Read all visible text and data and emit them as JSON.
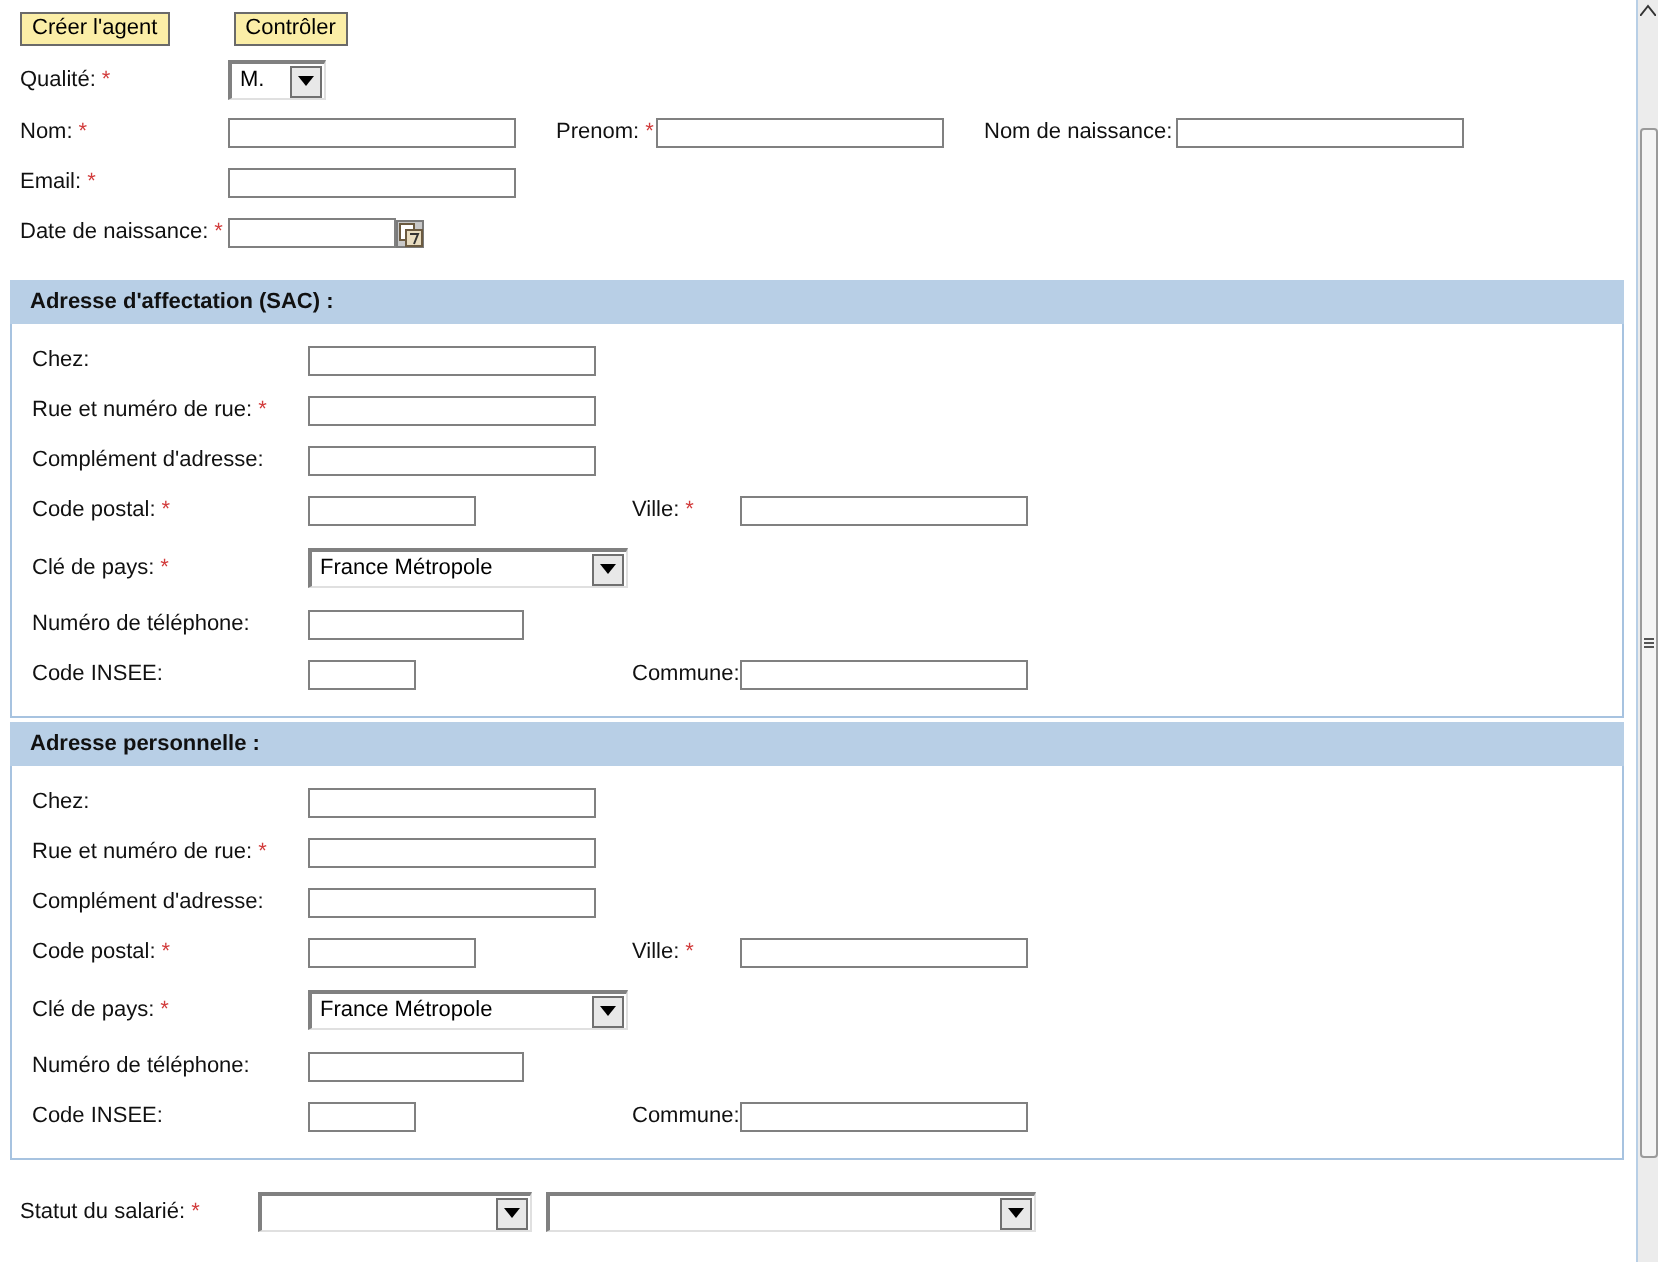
{
  "buttons": [
    {
      "label": "Créer l'agent"
    },
    {
      "label": "Contrôler"
    }
  ],
  "top_rows": [
    [
      {
        "label": "Qualité:",
        "required_mark": "*",
        "kind": "select",
        "value": "M."
      }
    ],
    [
      {
        "label": "Nom:",
        "required_mark": "*",
        "kind": "text"
      },
      {
        "label": "Prenom:",
        "required_mark": "*",
        "kind": "text"
      },
      {
        "label": "Nom de naissance:",
        "kind": "text"
      }
    ],
    [
      {
        "label": "Email:",
        "required_mark": "*",
        "kind": "text"
      }
    ],
    [
      {
        "label": "Date de naissance:",
        "required_mark": "*",
        "kind": "date"
      }
    ]
  ],
  "sections": [
    {
      "title": "Adresse d'affectation (SAC) :",
      "rows": [
        [
          {
            "label": "Chez:",
            "kind": "text"
          }
        ],
        [
          {
            "label": "Rue et numéro de rue:",
            "required_mark": "*",
            "kind": "text"
          }
        ],
        [
          {
            "label": "Complément d'adresse:",
            "kind": "text"
          }
        ],
        [
          {
            "label": "Code postal:",
            "required_mark": "*",
            "kind": "text"
          },
          {
            "label": "Ville:",
            "required_mark": "*",
            "kind": "text"
          }
        ],
        [
          {
            "label": "Clé de pays:",
            "required_mark": "*",
            "kind": "select",
            "value": "France Métropole"
          }
        ],
        [
          {
            "label": "Numéro de téléphone:",
            "kind": "text"
          }
        ],
        [
          {
            "label": "Code INSEE:",
            "kind": "text"
          },
          {
            "label": "Commune:",
            "kind": "text"
          }
        ]
      ]
    },
    {
      "title": "Adresse personnelle :",
      "rows": [
        [
          {
            "label": "Chez:",
            "kind": "text"
          }
        ],
        [
          {
            "label": "Rue et numéro de rue:",
            "required_mark": "*",
            "kind": "text"
          }
        ],
        [
          {
            "label": "Complément d'adresse:",
            "kind": "text"
          }
        ],
        [
          {
            "label": "Code postal:",
            "required_mark": "*",
            "kind": "text"
          },
          {
            "label": "Ville:",
            "required_mark": "*",
            "kind": "text"
          }
        ],
        [
          {
            "label": "Clé de pays:",
            "required_mark": "*",
            "kind": "select",
            "value": "France Métropole"
          }
        ],
        [
          {
            "label": "Numéro de téléphone:",
            "kind": "text"
          }
        ],
        [
          {
            "label": "Code INSEE:",
            "kind": "text"
          },
          {
            "label": "Commune:",
            "kind": "text"
          }
        ]
      ]
    }
  ],
  "statut": {
    "label": "Statut du salarié:",
    "required_mark": "*",
    "selects": [
      {
        "kind": "select"
      },
      {
        "kind": "select"
      }
    ]
  }
}
